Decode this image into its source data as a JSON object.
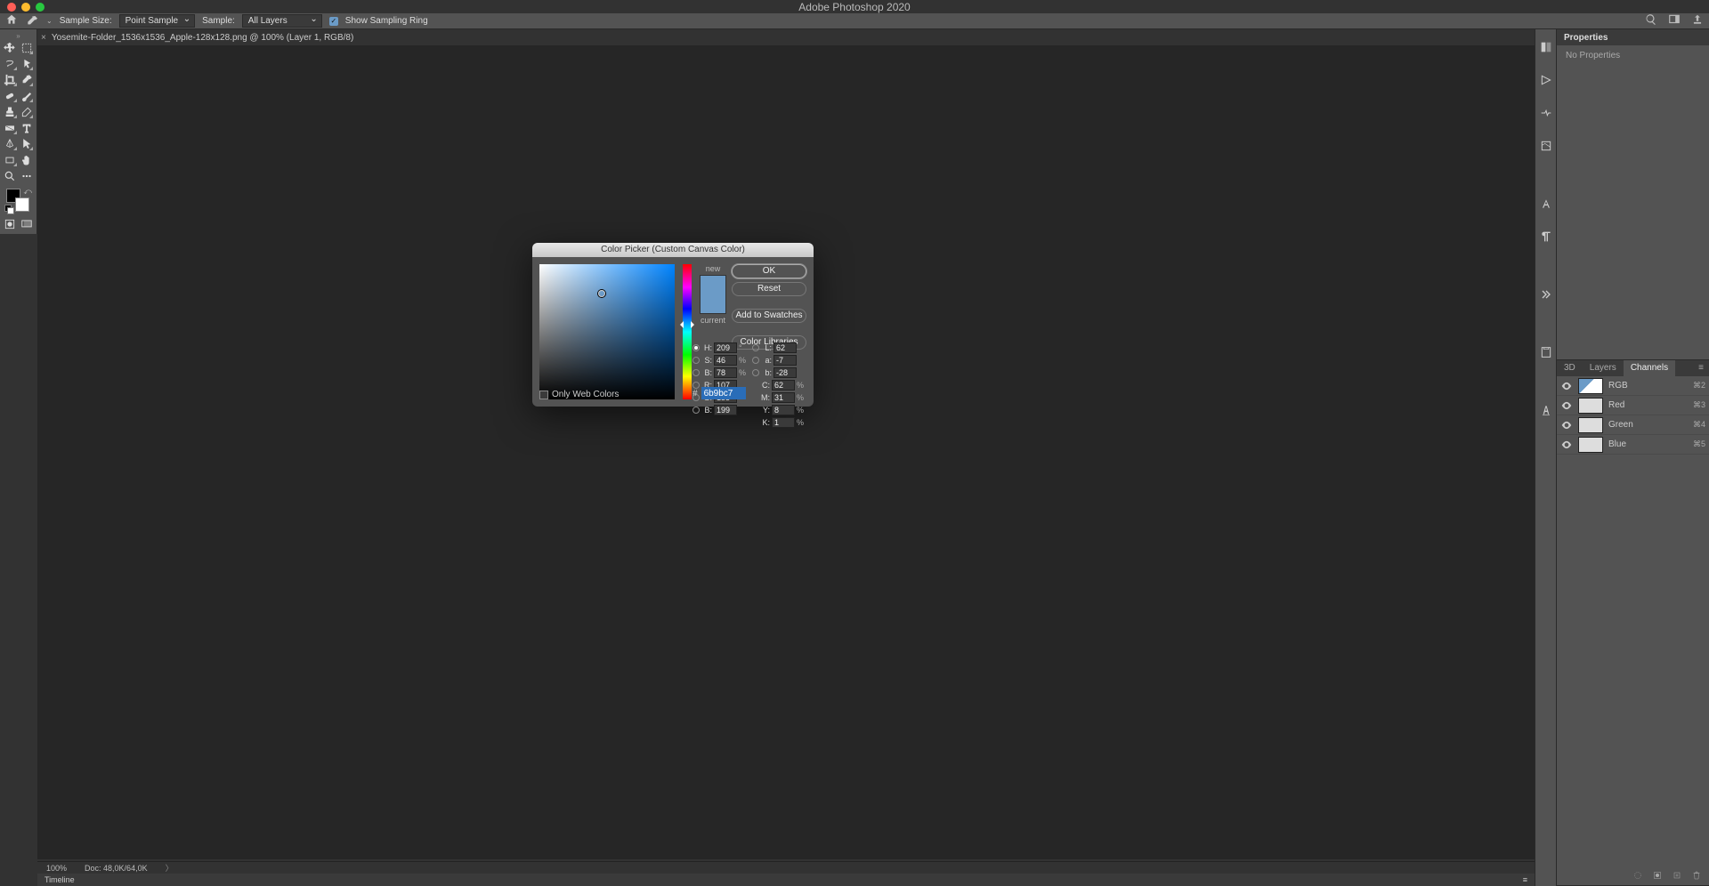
{
  "app_title": "Adobe Photoshop 2020",
  "options": {
    "sample_size_label": "Sample Size:",
    "sample_size_value": "Point Sample",
    "sample_label": "Sample:",
    "sample_value": "All Layers",
    "show_ring_label": "Show Sampling Ring"
  },
  "document_tab": "Yosemite-Folder_1536x1536_Apple-128x128.png @ 100% (Layer 1, RGB/8)",
  "status": {
    "zoom": "100%",
    "doc": "Doc: 48,0K/64,0K"
  },
  "timeline_label": "Timeline",
  "properties": {
    "title": "Properties",
    "body": "No Properties"
  },
  "panel_tabs": {
    "t1": "3D",
    "t2": "Layers",
    "t3": "Channels"
  },
  "channels": [
    {
      "name": "RGB",
      "shortcut": "⌘2"
    },
    {
      "name": "Red",
      "shortcut": "⌘3"
    },
    {
      "name": "Green",
      "shortcut": "⌘4"
    },
    {
      "name": "Blue",
      "shortcut": "⌘5"
    }
  ],
  "picker": {
    "title": "Color Picker (Custom Canvas Color)",
    "new_label": "new",
    "current_label": "current",
    "ok": "OK",
    "reset": "Reset",
    "add_swatch": "Add to Swatches",
    "libraries": "Color Libraries",
    "web_only": "Only Web Colors",
    "hex": "6b9bc7",
    "H": "209",
    "S": "46",
    "Bv": "78",
    "L": "62",
    "a": "-7",
    "b": "-28",
    "R": "107",
    "G": "155",
    "Bb": "199",
    "C": "62",
    "M": "31",
    "Y": "8",
    "K": "1",
    "deg": "°",
    "pct": "%",
    "hash": "#"
  }
}
